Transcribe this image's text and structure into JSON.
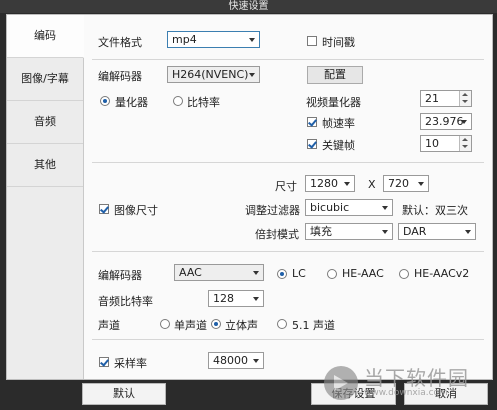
{
  "window": {
    "title": "快速设置"
  },
  "sidebar": {
    "items": [
      {
        "label": "编码",
        "active": true
      },
      {
        "label": "图像/字幕",
        "active": false
      },
      {
        "label": "音频",
        "active": false
      },
      {
        "label": "其他",
        "active": false
      }
    ]
  },
  "general": {
    "file_format_label": "文件格式",
    "file_format_value": "mp4",
    "timestamp_label": "时间戳",
    "timestamp_checked": false
  },
  "video": {
    "encoder_label": "编解码器",
    "encoder_value": "H264(NVENC)",
    "config_button": "配置",
    "quantizer_label": "量化器",
    "bitrate_label": "比特率",
    "mode_selected": "量化器",
    "video_quantizer_label": "视频量化器",
    "video_quantizer_value": "21",
    "framerate_label": "帧速率",
    "framerate_checked": true,
    "framerate_value": "23.976",
    "keyframe_label": "关键帧",
    "keyframe_checked": true,
    "keyframe_value": "10"
  },
  "image": {
    "size_label": "尺寸",
    "width_value": "1280",
    "x_label": "X",
    "height_value": "720",
    "image_size_label": "图像尺寸",
    "image_size_checked": true,
    "filter_label": "调整过滤器",
    "filter_value": "bicubic",
    "filter_default_label": "默认：双三次",
    "aspect_mode_label": "倍封模式",
    "aspect_mode_value": "填充",
    "aspect_value": "DAR"
  },
  "audio": {
    "codec_label": "编解码器",
    "codec_value": "AAC",
    "profile_options": [
      "LC",
      "HE-AAC",
      "HE-AACv2"
    ],
    "profile_selected": "LC",
    "bitrate_label": "音频比特率",
    "bitrate_value": "128",
    "channel_label": "声道",
    "channel_options": [
      "单声道",
      "立体声",
      "5.1 声道"
    ],
    "channel_selected": "立体声",
    "samplerate_label": "采样率",
    "samplerate_checked": true,
    "samplerate_value": "48000"
  },
  "footer": {
    "default_button": "默认",
    "save_button": "保存设置",
    "cancel_button": "取消"
  },
  "watermark": {
    "text": "当下软件园",
    "url": "www.downxia.com"
  }
}
